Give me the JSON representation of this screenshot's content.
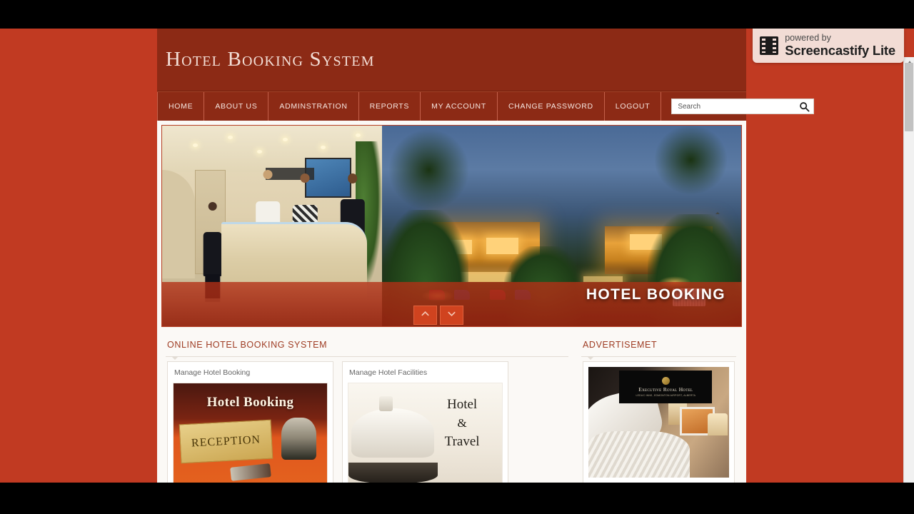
{
  "window": {
    "letterbox_color": "#000000",
    "page_background": "#C13A22",
    "header_color": "#8C2A15"
  },
  "header": {
    "brand": "Hotel Booking System"
  },
  "nav": {
    "items": [
      {
        "label": "Home",
        "name": "nav-home"
      },
      {
        "label": "About Us",
        "name": "nav-about-us"
      },
      {
        "label": "Adminstration",
        "name": "nav-administration"
      },
      {
        "label": "Reports",
        "name": "nav-reports"
      },
      {
        "label": "My Account",
        "name": "nav-my-account"
      },
      {
        "label": "Change Password",
        "name": "nav-change-password"
      },
      {
        "label": "Logout",
        "name": "nav-logout"
      }
    ]
  },
  "search": {
    "value": "",
    "placeholder": "Search",
    "icon": "search-icon"
  },
  "hero": {
    "caption": "HOTEL BOOKING",
    "prev_icon": "chevron-up-icon",
    "next_icon": "chevron-down-icon",
    "scene_left": "hotel lobby reception desk with guests and staff",
    "scene_right": "tropical resort villas illuminated at dusk with pool loungers"
  },
  "main": {
    "section_title": "Online Hotel Booking System",
    "cards": [
      {
        "title": "Manage Hotel Booking",
        "image_title": "Hotel Booking",
        "image_plate": "RECEPTION"
      },
      {
        "title": "Manage Hotel Facilities",
        "image_line1": "Hotel",
        "image_line2": "&",
        "image_line3": "Travel"
      }
    ]
  },
  "sidebar": {
    "section_title": "Advertisemet",
    "ad": {
      "logo_line1": "Executive Royal Hotel",
      "logo_line2": "LEDUC INNS, EDMONTON AIRPORT, ALBERTA",
      "alt": "hotel bedroom with white linens"
    }
  },
  "scrollbar": {
    "up_icon": "caret-up-icon",
    "down_icon": "caret-down-icon"
  },
  "watermark": {
    "line1": "powered by",
    "line2": "Screencastify Lite",
    "icon": "film-strip-icon"
  }
}
